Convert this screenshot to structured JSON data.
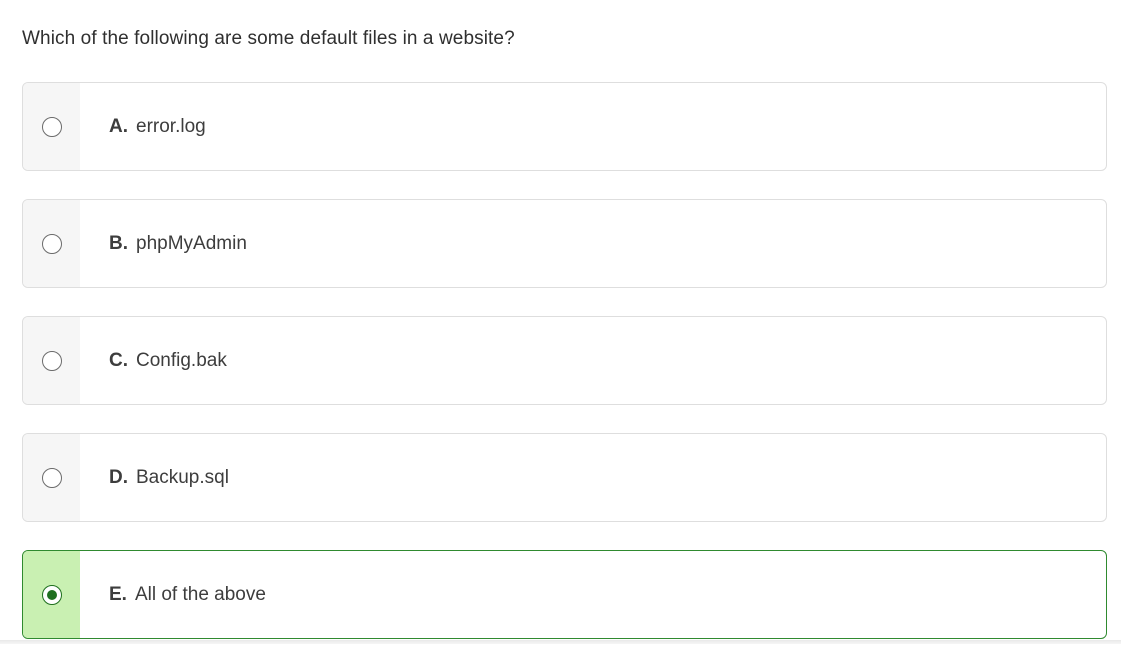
{
  "question": "Which of the following are some default files in a website?",
  "options": [
    {
      "letter": "A.",
      "text": "error.log",
      "selected": false
    },
    {
      "letter": "B.",
      "text": "phpMyAdmin",
      "selected": false
    },
    {
      "letter": "C.",
      "text": "Config.bak",
      "selected": false
    },
    {
      "letter": "D.",
      "text": "Backup.sql",
      "selected": false
    },
    {
      "letter": "E.",
      "text": "All of the above",
      "selected": true
    }
  ],
  "colors": {
    "selected_border": "#2f8a2f",
    "selected_fill": "#c9f0b2",
    "radio_selected": "#1f6f1f",
    "unselected_gutter": "#f6f6f6"
  },
  "icons": {
    "radio_unselected": "radio-unchecked-icon",
    "radio_selected": "radio-checked-icon"
  }
}
